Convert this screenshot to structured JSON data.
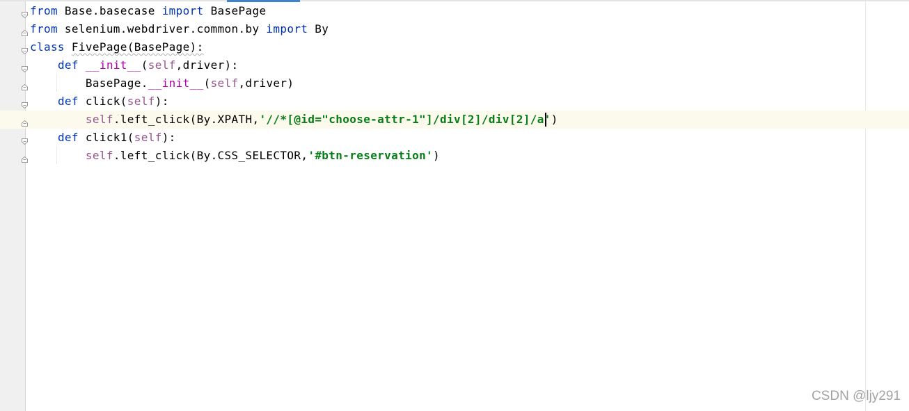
{
  "editor": {
    "current_line": 7,
    "lines": [
      {
        "tokens": [
          {
            "t": "from",
            "c": "kw"
          },
          {
            "t": " Base.basecase ",
            "c": ""
          },
          {
            "t": "import",
            "c": "kw"
          },
          {
            "t": " BasePage",
            "c": ""
          }
        ]
      },
      {
        "tokens": [
          {
            "t": "from",
            "c": "kw"
          },
          {
            "t": " selenium.webdriver.common.by ",
            "c": ""
          },
          {
            "t": "import",
            "c": "kw"
          },
          {
            "t": " By",
            "c": ""
          }
        ]
      },
      {
        "tokens": [
          {
            "t": "class",
            "c": "kw"
          },
          {
            "t": " ",
            "c": ""
          },
          {
            "t": "FivePage(BasePage):",
            "c": "sqg"
          }
        ]
      },
      {
        "tokens": [
          {
            "t": "    ",
            "c": ""
          },
          {
            "t": "def",
            "c": "kw"
          },
          {
            "t": " ",
            "c": ""
          },
          {
            "t": "__init__",
            "c": "magic"
          },
          {
            "t": "(",
            "c": ""
          },
          {
            "t": "self",
            "c": "self"
          },
          {
            "t": ",driver):",
            "c": ""
          }
        ]
      },
      {
        "tokens": [
          {
            "t": "        BasePage.",
            "c": ""
          },
          {
            "t": "__init__",
            "c": "magic"
          },
          {
            "t": "(",
            "c": ""
          },
          {
            "t": "self",
            "c": "self"
          },
          {
            "t": ",driver)",
            "c": ""
          }
        ]
      },
      {
        "tokens": [
          {
            "t": "    ",
            "c": ""
          },
          {
            "t": "def",
            "c": "kw"
          },
          {
            "t": " click(",
            "c": ""
          },
          {
            "t": "self",
            "c": "self"
          },
          {
            "t": "):",
            "c": ""
          }
        ]
      },
      {
        "tokens": [
          {
            "t": "        ",
            "c": ""
          },
          {
            "t": "self",
            "c": "self"
          },
          {
            "t": ".left_click(By.XPATH,",
            "c": ""
          },
          {
            "t": "'//*[@id=\"choose-attr-1\"]/div[2]/div[2]/a'",
            "c": "str"
          },
          {
            "t": ")",
            "c": ""
          }
        ]
      },
      {
        "tokens": [
          {
            "t": "    ",
            "c": ""
          },
          {
            "t": "def",
            "c": "kw"
          },
          {
            "t": " click1(",
            "c": ""
          },
          {
            "t": "self",
            "c": "self"
          },
          {
            "t": "):",
            "c": ""
          }
        ]
      },
      {
        "tokens": [
          {
            "t": "        ",
            "c": ""
          },
          {
            "t": "self",
            "c": "self"
          },
          {
            "t": ".left_click(By.CSS_SELECTOR,",
            "c": ""
          },
          {
            "t": "'#btn-reservation'",
            "c": "str"
          },
          {
            "t": ")",
            "c": ""
          }
        ]
      }
    ],
    "folds": [
      {
        "line": 1,
        "icon": "fold-open-icon"
      },
      {
        "line": 2,
        "icon": "fold-close-icon"
      },
      {
        "line": 3,
        "icon": "fold-open-icon"
      },
      {
        "line": 4,
        "icon": "fold-open-icon"
      },
      {
        "line": 5,
        "icon": "fold-close-icon"
      },
      {
        "line": 6,
        "icon": "fold-open-icon"
      },
      {
        "line": 7,
        "icon": "fold-close-icon"
      },
      {
        "line": 8,
        "icon": "fold-open-icon"
      },
      {
        "line": 9,
        "icon": "fold-close-icon"
      }
    ]
  },
  "colors": {
    "keyword": "#0033b3",
    "self": "#94558d",
    "magic": "#b200b2",
    "string": "#067d17",
    "current_line": "#fcfaed",
    "gutter": "#f0f0f0",
    "accent": "#4083c9"
  },
  "watermark": "CSDN @ljy291"
}
